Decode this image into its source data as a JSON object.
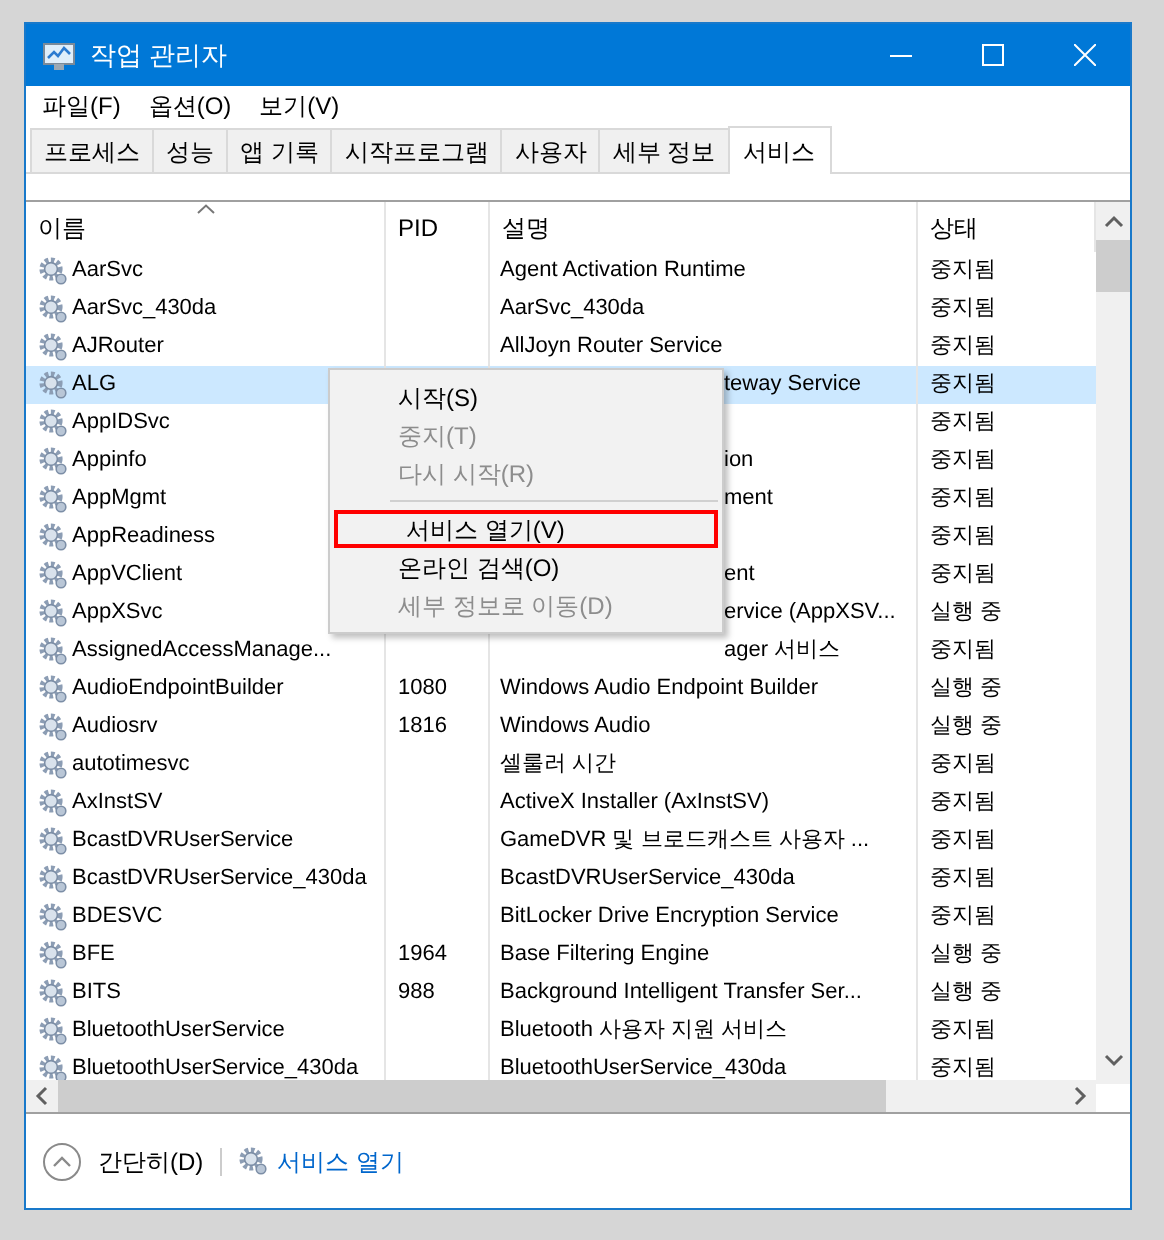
{
  "window": {
    "title": "작업 관리자"
  },
  "menu_bar": [
    "파일(F)",
    "옵션(O)",
    "보기(V)"
  ],
  "tabs": [
    {
      "label": "프로세스",
      "selected": false
    },
    {
      "label": "성능",
      "selected": false
    },
    {
      "label": "앱 기록",
      "selected": false
    },
    {
      "label": "시작프로그램",
      "selected": false
    },
    {
      "label": "사용자",
      "selected": false
    },
    {
      "label": "세부 정보",
      "selected": false
    },
    {
      "label": "서비스",
      "selected": true
    }
  ],
  "table": {
    "columns": [
      {
        "label": "이름",
        "sorted": true
      },
      {
        "label": "PID",
        "sorted": false
      },
      {
        "label": "설명",
        "sorted": false
      },
      {
        "label": "상태",
        "sorted": false
      }
    ],
    "rows": [
      {
        "name": "AarSvc",
        "description": "Agent Activation Runtime",
        "status": "중지됨",
        "selected": false
      },
      {
        "name": "AarSvc_430da",
        "description": "AarSvc_430da",
        "status": "중지됨",
        "selected": false
      },
      {
        "name": "AJRouter",
        "description": "AllJoyn Router Service",
        "status": "중지됨",
        "selected": false
      },
      {
        "name": "ALG",
        "description": "teway Service",
        "description_partly_hidden": true,
        "status": "중지됨",
        "selected": true
      },
      {
        "name": "AppIDSvc",
        "status": "중지됨",
        "selected": false
      },
      {
        "name": "Appinfo",
        "description": "ion",
        "description_partly_hidden": true,
        "status": "중지됨",
        "selected": false
      },
      {
        "name": "AppMgmt",
        "description": "ment",
        "description_partly_hidden": true,
        "status": "중지됨",
        "selected": false
      },
      {
        "name": "AppReadiness",
        "status": "중지됨",
        "selected": false
      },
      {
        "name": "AppVClient",
        "description": "ent",
        "description_partly_hidden": true,
        "status": "중지됨",
        "selected": false
      },
      {
        "name": "AppXSvc",
        "description": "ervice (AppXSV...",
        "description_partly_hidden": true,
        "status": "실행 중",
        "selected": false
      },
      {
        "name": "AssignedAccessManage...",
        "description": "ager 서비스",
        "description_partly_hidden": true,
        "status": "중지됨",
        "selected": false
      },
      {
        "name": "AudioEndpointBuilder",
        "pid": "1080",
        "description": "Windows Audio Endpoint Builder",
        "status": "실행 중",
        "selected": false
      },
      {
        "name": "Audiosrv",
        "pid": "1816",
        "description": "Windows Audio",
        "status": "실행 중",
        "selected": false
      },
      {
        "name": "autotimesvc",
        "description": "셀룰러 시간",
        "status": "중지됨",
        "selected": false
      },
      {
        "name": "AxInstSV",
        "description": "ActiveX Installer (AxInstSV)",
        "status": "중지됨",
        "selected": false
      },
      {
        "name": "BcastDVRUserService",
        "description": "GameDVR 및 브로드캐스트 사용자 ...",
        "status": "중지됨",
        "selected": false
      },
      {
        "name": "BcastDVRUserService_430da",
        "description": "BcastDVRUserService_430da",
        "status": "중지됨",
        "selected": false
      },
      {
        "name": "BDESVC",
        "description": "BitLocker Drive Encryption Service",
        "status": "중지됨",
        "selected": false
      },
      {
        "name": "BFE",
        "pid": "1964",
        "description": "Base Filtering Engine",
        "status": "실행 중",
        "selected": false
      },
      {
        "name": "BITS",
        "pid": "988",
        "description": "Background Intelligent Transfer Ser...",
        "status": "실행 중",
        "selected": false
      },
      {
        "name": "BluetoothUserService",
        "description": "Bluetooth 사용자 지원 서비스",
        "status": "중지됨",
        "selected": false
      },
      {
        "name": "BluetoothUserService_430da",
        "description": "BluetoothUserService_430da",
        "status": "중지됨",
        "selected": false
      }
    ]
  },
  "context_menu": {
    "items": [
      {
        "kind": "item",
        "label": "시작(S)",
        "disabled": false,
        "outlined": false
      },
      {
        "kind": "item",
        "label": "중지(T)",
        "disabled": true,
        "outlined": false
      },
      {
        "kind": "item",
        "label": "다시 시작(R)",
        "disabled": true,
        "outlined": false
      },
      {
        "kind": "separator"
      },
      {
        "kind": "item",
        "label": "서비스 열기(V)",
        "disabled": false,
        "outlined": true
      },
      {
        "kind": "item",
        "label": "온라인 검색(O)",
        "disabled": false,
        "outlined": false
      },
      {
        "kind": "item",
        "label": "세부 정보로 이동(D)",
        "disabled": true,
        "outlined": false
      }
    ]
  },
  "footer": {
    "collapse_label": "간단히(D)",
    "link": "서비스 열기"
  }
}
